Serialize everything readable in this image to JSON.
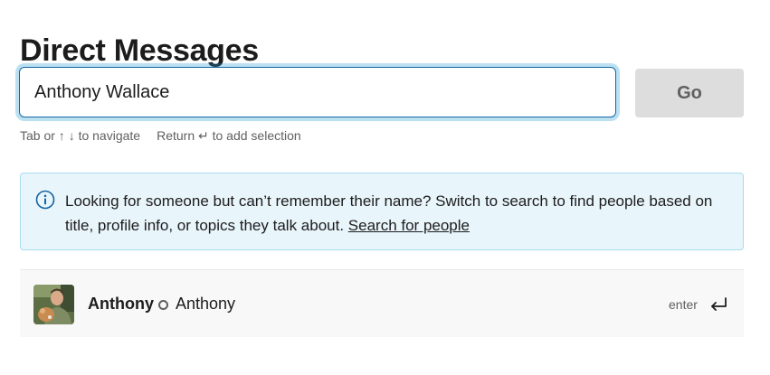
{
  "page": {
    "title": "Direct Messages"
  },
  "search": {
    "value": "Anthony Wallace",
    "go_label": "Go"
  },
  "hint": {
    "navigate": "Tab or ↑ ↓ to navigate",
    "select": "Return ↵ to add selection"
  },
  "info": {
    "icon": "info-icon",
    "text": "Looking for someone but can’t remember their name? Switch to search to find people based on title, profile info, or topics they talk about.",
    "link": "Search for people"
  },
  "results": [
    {
      "name": "Anthony",
      "display_name": "Anthony",
      "presence": "away",
      "enter_label": "enter",
      "enter_icon": "return-arrow-icon"
    }
  ],
  "colors": {
    "focus_border": "#1264a3",
    "info_bg": "#e8f5fa",
    "info_icon": "#1264a3",
    "button_bg": "#dddddd"
  }
}
